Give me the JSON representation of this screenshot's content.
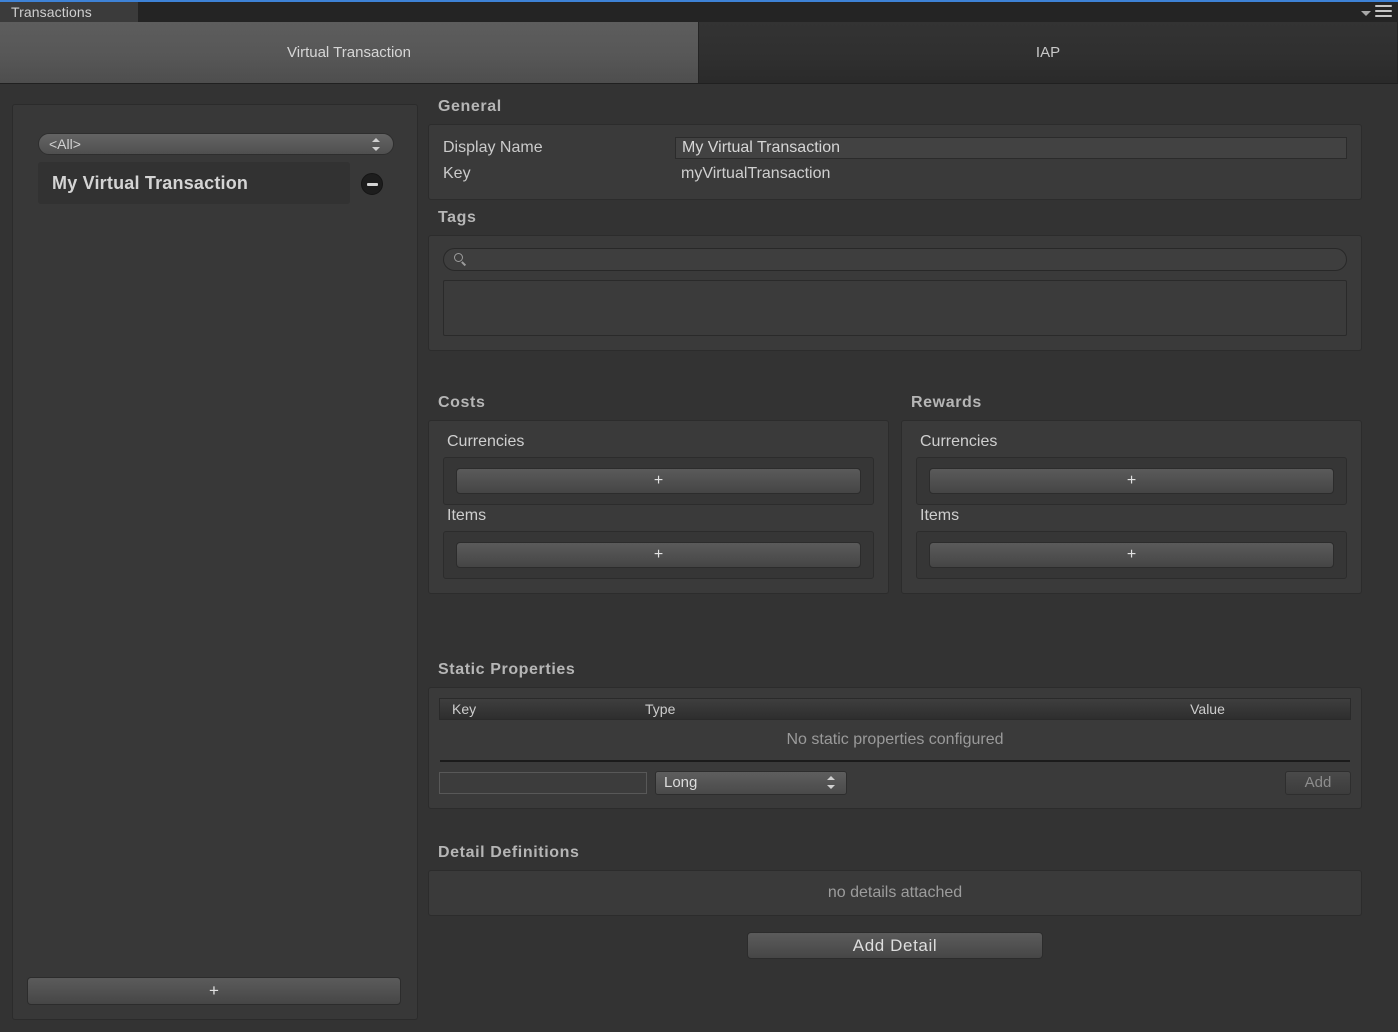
{
  "window": {
    "tab_title": "Transactions",
    "menu_icon": "hamburger-menu-icon",
    "caret_icon": "chevron-down-icon",
    "accent_color": "#3e82d6"
  },
  "mode_tabs": [
    {
      "label": "Virtual Transaction",
      "active": true
    },
    {
      "label": "IAP",
      "active": false
    }
  ],
  "sidebar": {
    "filter": {
      "value": "<All>",
      "stepper_icon": "updown-stepper-icon"
    },
    "items": [
      {
        "label": "My Virtual Transaction",
        "selected": true,
        "remove_icon": "minus-circle-icon"
      }
    ],
    "add_button_label": "+"
  },
  "general": {
    "title": "General",
    "display_name_label": "Display Name",
    "display_name_value": "My Virtual Transaction",
    "key_label": "Key",
    "key_value": "myVirtualTransaction"
  },
  "tags": {
    "title": "Tags",
    "search_icon": "search-icon",
    "search_value": "",
    "search_placeholder": "",
    "list_items": []
  },
  "costs": {
    "title": "Costs",
    "currencies_label": "Currencies",
    "currencies_add_label": "+",
    "items_label": "Items",
    "items_add_label": "+"
  },
  "rewards": {
    "title": "Rewards",
    "currencies_label": "Currencies",
    "currencies_add_label": "+",
    "items_label": "Items",
    "items_add_label": "+"
  },
  "static_properties": {
    "title": "Static Properties",
    "columns": [
      "Key",
      "Type",
      "Value"
    ],
    "rows": [],
    "empty_message": "No static properties configured",
    "new_key_value": "",
    "new_key_placeholder": "",
    "new_type_value": "Long",
    "type_stepper_icon": "updown-stepper-icon",
    "add_button_label": "Add"
  },
  "detail_definitions": {
    "title": "Detail Definitions",
    "empty_message": "no details attached",
    "add_button_label": "Add Detail"
  }
}
